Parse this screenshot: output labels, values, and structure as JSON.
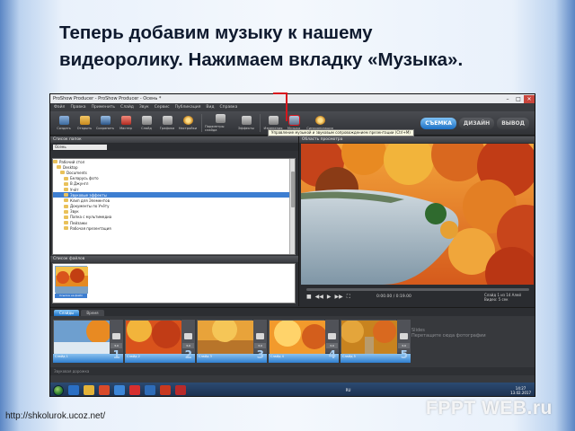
{
  "slide": {
    "caption_line1": "Теперь добавим музыку к нашему",
    "caption_line2": "видеоролику. Нажимаем вкладку «Музыка».",
    "source_url": "http://shkolurok.ucoz.net/",
    "watermark": "FPPT WEB.ru"
  },
  "app": {
    "title": "ProShow Producer - ProShow Producer - Осень *",
    "window_buttons": [
      "–",
      "□",
      "✕"
    ],
    "menu": [
      "Файл",
      "Правка",
      "Применить",
      "Слайд",
      "Звук",
      "Сервис",
      "Публикация",
      "Вид",
      "Справка"
    ],
    "toolbar": [
      {
        "label": "Создать",
        "icon": "new-show-icon",
        "color": "#5f8fc8"
      },
      {
        "label": "Открыть",
        "icon": "open-folder-icon",
        "color": "#e0a93c"
      },
      {
        "label": "Сохранить",
        "icon": "save-disk-icon",
        "color": "#4a78b0"
      },
      {
        "label": "Мастер",
        "icon": "wizard-icon",
        "color": "#c9473b"
      },
      {
        "label": "Слайд",
        "icon": "slide-icon",
        "color": "#a0a0a0"
      },
      {
        "label": "Графика",
        "icon": "graphics-icon",
        "color": "#a0a0a0"
      },
      {
        "label": "Настройки",
        "icon": "settings-icon",
        "color": "#e2a63a"
      },
      {
        "label": "Параметры слайда",
        "icon": "slide-options-icon",
        "color": "#a0a0a0"
      },
      {
        "label": "Эффекты",
        "icon": "effects-icon",
        "color": "#a0a0a0"
      },
      {
        "label": "Изменения",
        "icon": "changes-icon",
        "color": "#a0a0a0"
      },
      {
        "label": "Музыка",
        "icon": "music-icon",
        "color": "#8ea4c2"
      },
      {
        "label": "Синхронизация",
        "icon": "sync-icon",
        "color": "#e6c04a"
      }
    ],
    "mode_tabs": [
      "СЪЕМКА",
      "ДИЗАЙН",
      "ВЫВОД"
    ],
    "active_mode": "СЪЕМКА",
    "tooltip": "Управление музыкой и звуковым сопровождением презентации (Ctrl+M)",
    "left_panel": {
      "header": "Список папок",
      "view_label": "Осень",
      "tree": [
        "Рабочий стол",
        "Desktop",
        "Documents",
        "Беларусь фото",
        "В Джунгл",
        "Учёт",
        "Звуковые эффекты",
        "Клип для Элементов",
        "Документы по Учёту",
        "Звук",
        "Папка с мультимедиа",
        "Пейзажи",
        "Рабочая презентация"
      ],
      "tree_selected_index": 6,
      "selection_header": "Список файлов",
      "selected_file": "Ссылка на файл"
    },
    "right_panel": {
      "header": "Область просмотра",
      "time": "0:00.00 / 0:19.00",
      "slide_info_line1": "Слайд 1 из 14 Алей",
      "slide_info_line2": "Видео: 5 сек"
    },
    "timeline": {
      "tabs": [
        "Слайды",
        "Время"
      ],
      "active_tab": "Слайды",
      "slides": [
        {
          "label": "Слайд 1",
          "number": "1",
          "duration": "3.0"
        },
        {
          "label": "Слайд 2",
          "number": "2",
          "duration": "3.0"
        },
        {
          "label": "Слайд 3",
          "number": "3",
          "duration": "3.0"
        },
        {
          "label": "Слайд 4",
          "number": "4",
          "duration": "3.0"
        },
        {
          "label": "Слайд 5",
          "number": "5",
          "duration": "3.0"
        }
      ],
      "hint_title": "Slides",
      "hint_text": "Перетащите сюда фотографии",
      "sound_track": "Звуковая дорожка"
    },
    "taskbar": {
      "clock_time": "14:27",
      "clock_date": "13.02.2017",
      "tray_lang": "RU"
    }
  }
}
